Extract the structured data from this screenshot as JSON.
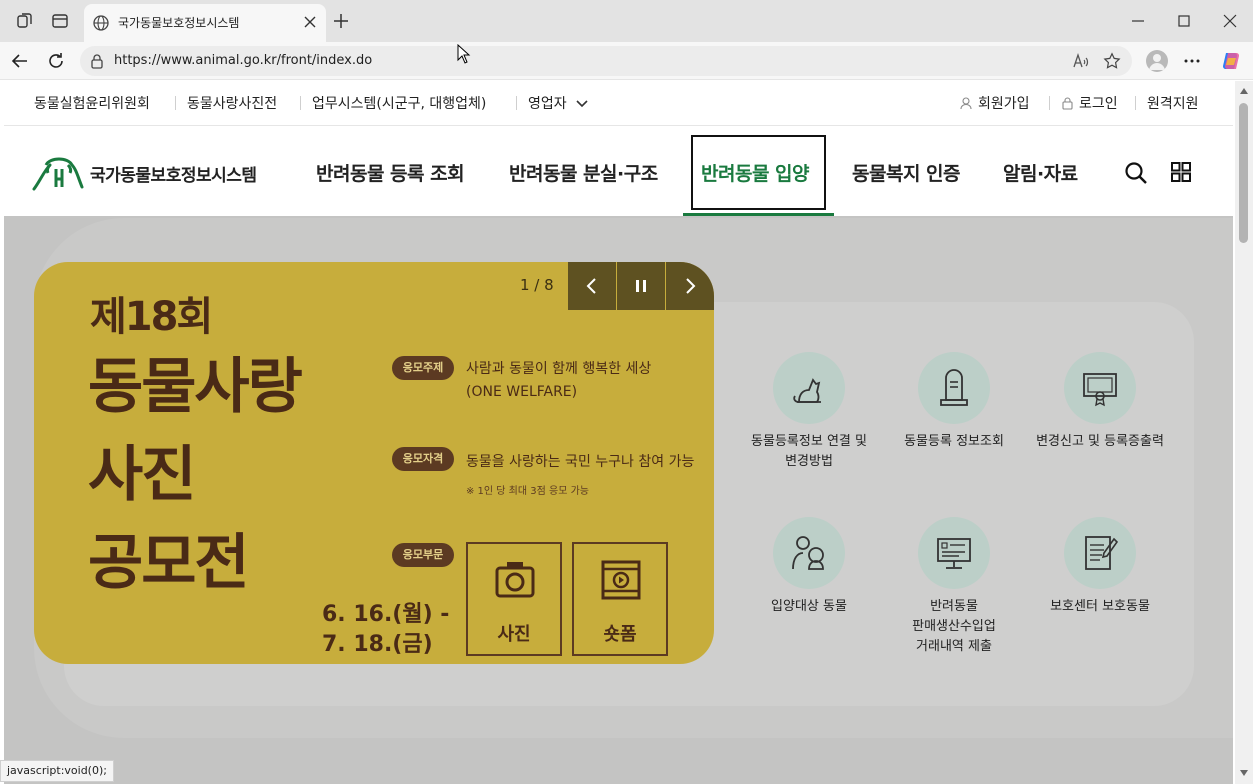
{
  "browser": {
    "tab_title": "국가동물보호정보시스템",
    "url": "https://www.animal.go.kr/front/index.do",
    "status_text": "javascript:void(0);"
  },
  "utility": {
    "left_links": [
      "동물실험윤리위원회",
      "동물사랑사진전",
      "업무시스템(시군구, 대행업체)",
      "영업자"
    ],
    "signup": "회원가입",
    "login": "로그인",
    "remote": "원격지원"
  },
  "header": {
    "logo_text": "국가동물보호정보시스템",
    "menu": [
      "반려동물 등록 조회",
      "반려동물 분실·구조",
      "반려동물 입양",
      "동물복지 인증",
      "알림·자료"
    ],
    "active_index": 2
  },
  "banner": {
    "counter": "1 / 8",
    "edition": "제18회",
    "title_lines": [
      "동물사랑",
      "사진",
      "공모전"
    ],
    "tags": [
      "응모주제",
      "응모자격",
      "응모부문"
    ],
    "theme_line1": "사람과 동물이 함께 행복한 세상",
    "theme_line2": "(ONE WELFARE)",
    "eligibility": "동물을 사랑하는 국민 누구나 참여 가능",
    "note": "※ 1인 당 최대 3점 응모 가능",
    "date_line1": "6. 16.(월) -",
    "date_line2": "7. 18.(금)",
    "category_photo": "사진",
    "category_shortform": "숏폼"
  },
  "quick_links": [
    {
      "label": "동물등록정보 연결 및\n변경방법",
      "icon": "dog-icon"
    },
    {
      "label": "동물등록 정보조회",
      "icon": "tombstone-icon"
    },
    {
      "label": "변경신고 및 등록증출력",
      "icon": "certificate-icon"
    },
    {
      "label": "입양대상 동물",
      "icon": "person-dog-icon"
    },
    {
      "label": "반려동물\n판매생산수입업\n거래내역 제출",
      "icon": "monitor-document-icon"
    },
    {
      "label": "보호센터 보호동물",
      "icon": "notepad-icon"
    }
  ],
  "colors": {
    "brand_green": "#1a7a3f",
    "banner_yellow": "#c7ad3c",
    "banner_brown": "#4a2a16"
  }
}
